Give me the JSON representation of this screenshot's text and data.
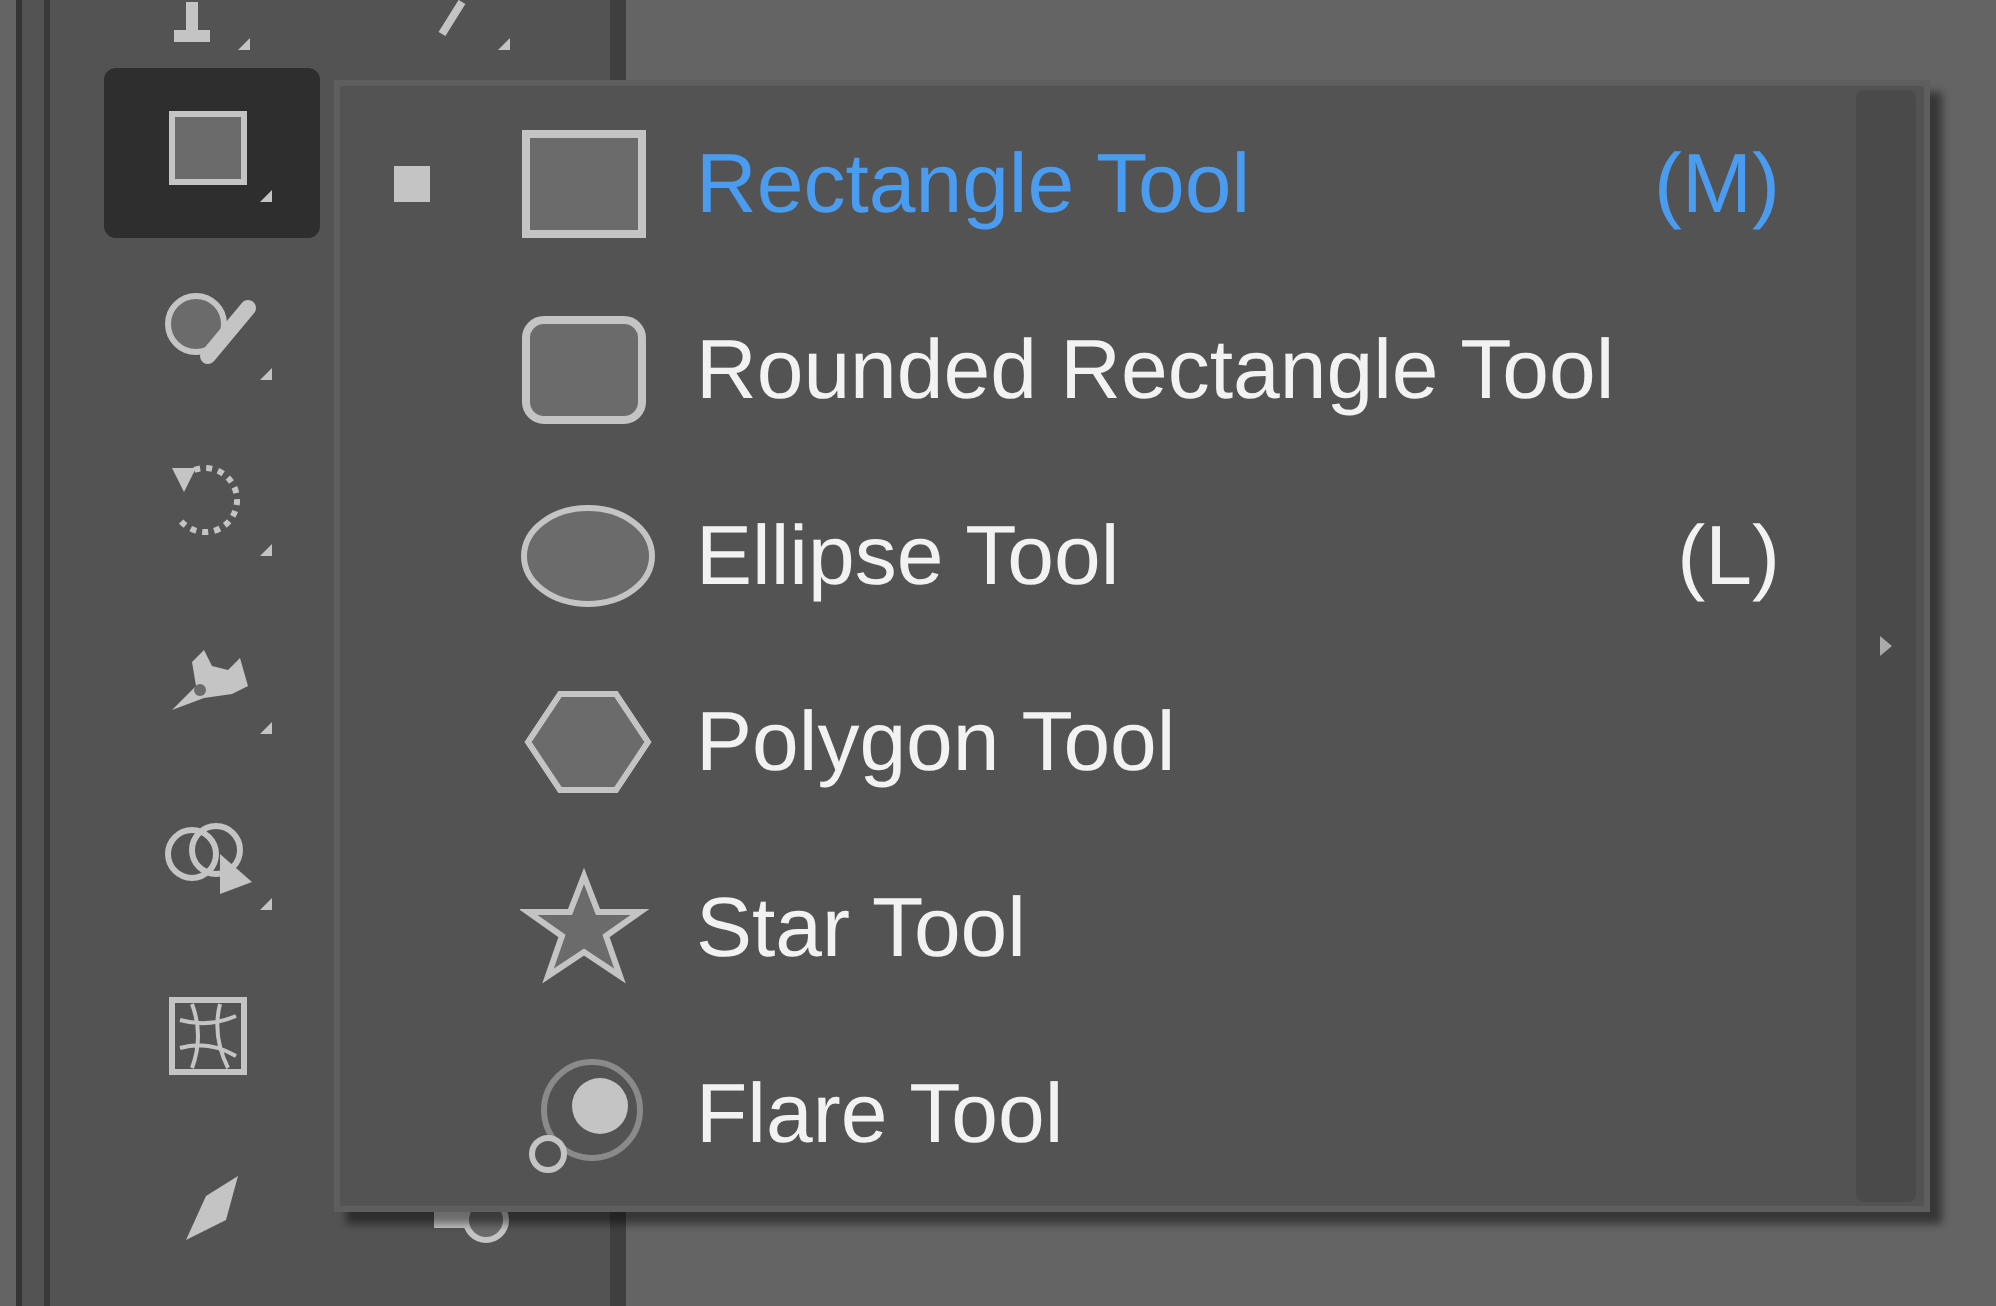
{
  "toolbar": {
    "rows": [
      {
        "tools": [
          {
            "kind": "type",
            "selected": false
          },
          {
            "kind": "line",
            "selected": false
          }
        ]
      },
      {
        "tools": [
          {
            "kind": "rectangle",
            "selected": true
          }
        ]
      },
      {
        "tools": [
          {
            "kind": "shaper",
            "selected": false
          }
        ]
      },
      {
        "tools": [
          {
            "kind": "rotate",
            "selected": false
          }
        ]
      },
      {
        "tools": [
          {
            "kind": "puppet",
            "selected": false
          }
        ]
      },
      {
        "tools": [
          {
            "kind": "shape-builder",
            "selected": false
          }
        ]
      },
      {
        "tools": [
          {
            "kind": "mesh",
            "selected": false
          }
        ]
      },
      {
        "tools": [
          {
            "kind": "nib",
            "selected": false
          },
          {
            "kind": "gradient",
            "selected": false
          }
        ]
      }
    ]
  },
  "flyout_menu": {
    "items": [
      {
        "kind": "rectangle",
        "label": "Rectangle Tool",
        "shortcut": "(M)",
        "selected": true
      },
      {
        "kind": "rounded-rectangle",
        "label": "Rounded Rectangle Tool",
        "selected": false
      },
      {
        "kind": "ellipse",
        "label": "Ellipse Tool",
        "shortcut": "(L)",
        "selected": false
      },
      {
        "kind": "polygon",
        "label": "Polygon Tool",
        "selected": false
      },
      {
        "kind": "star",
        "label": "Star Tool",
        "selected": false
      },
      {
        "kind": "flare",
        "label": "Flare Tool",
        "selected": false
      }
    ]
  }
}
